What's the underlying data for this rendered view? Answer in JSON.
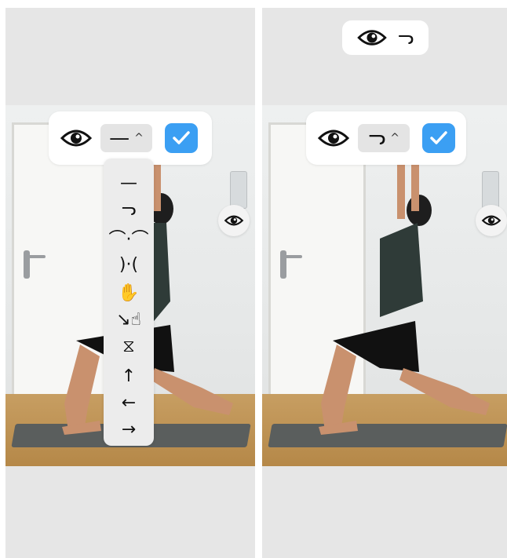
{
  "left_panel": {
    "toolbar": {
      "eye_icon": "eye-icon",
      "selected_glyph": "—",
      "caret": "^",
      "confirm_icon": "check-icon"
    },
    "dropdown": {
      "items": [
        {
          "glyph": "—",
          "icon": "line-icon"
        },
        {
          "glyph": "ᓓ",
          "icon": "nose-icon"
        },
        {
          "glyph": "⌒·⌒",
          "icon": "eyebrows-icon"
        },
        {
          "glyph": ")·(",
          "icon": "cheeks-icon"
        },
        {
          "glyph": "✋",
          "icon": "hand-icon"
        },
        {
          "glyph": "↘☝",
          "icon": "finger-point-icon"
        },
        {
          "glyph": "⧖",
          "icon": "foot-icon"
        },
        {
          "glyph": "↑",
          "icon": "arrow-up-icon"
        },
        {
          "glyph": "←",
          "icon": "arrow-left-icon"
        },
        {
          "glyph": "→",
          "icon": "arrow-right-icon"
        }
      ]
    },
    "side_button_icon": "eye-icon"
  },
  "right_panel": {
    "top_pill": {
      "eye_icon": "eye-icon",
      "glyph": "ᓓ"
    },
    "toolbar": {
      "eye_icon": "eye-icon",
      "selected_glyph": "ᓓ",
      "caret": "^",
      "confirm_icon": "check-icon"
    },
    "side_button_icon": "eye-icon"
  },
  "colors": {
    "accent": "#3b9ff3",
    "panel_bg": "#e6e6e6",
    "toolbar_bg": "#ffffff"
  }
}
